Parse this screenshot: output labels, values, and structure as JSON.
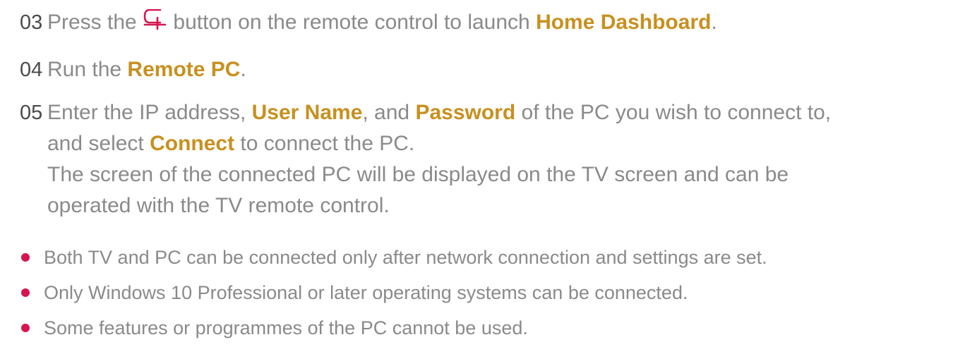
{
  "steps": [
    {
      "number": "03",
      "before": "Press the ",
      "icon": "home-icon",
      "after": " button on the remote control to launch ",
      "highlight": "Home Dashboard",
      "end": "."
    },
    {
      "number": "04",
      "before": "Run the ",
      "highlight": "Remote PC",
      "end": "."
    },
    {
      "number": "05",
      "p1": "Enter the IP address, ",
      "h1": "User Name",
      "p2": ", and ",
      "h2": "Password",
      "p3": " of the PC you wish to connect to,",
      "p4": "and select ",
      "h3": "Connect",
      "p5": " to connect the PC.",
      "note1": "The screen of the connected PC will be displayed on the TV screen and can be",
      "note2": "operated with the TV remote control."
    }
  ],
  "notes": [
    "Both TV and PC can be connected only after network connection and settings are set.",
    "Only Windows 10 Professional or later operating systems can be connected.",
    "Some features or programmes of the PC cannot be used."
  ],
  "colors": {
    "highlight": "#c8901f",
    "bullet": "#d6154e",
    "icon": "#d6154e",
    "text": "#8a8a8a"
  }
}
